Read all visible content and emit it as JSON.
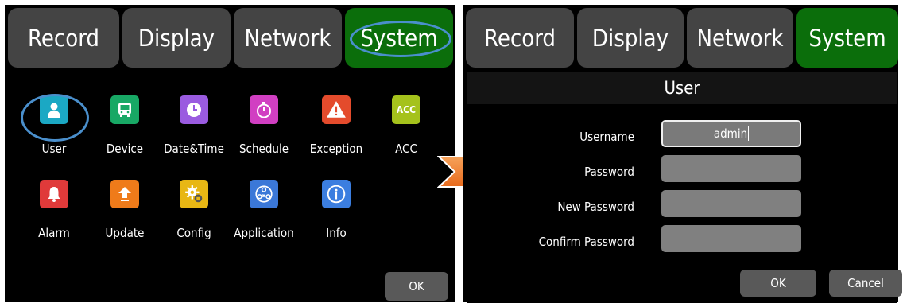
{
  "tabs": [
    "Record",
    "Display",
    "Network",
    "System"
  ],
  "active_tab": "System",
  "grid_items": [
    {
      "label": "User",
      "icon": "user-icon",
      "color": "#1ba8c4"
    },
    {
      "label": "Device",
      "icon": "bus-icon",
      "color": "#18a865"
    },
    {
      "label": "Date&Time",
      "icon": "clock-icon",
      "color": "#9a5be0"
    },
    {
      "label": "Schedule",
      "icon": "stopwatch-icon",
      "color": "#d13fc2"
    },
    {
      "label": "Exception",
      "icon": "warning-icon",
      "color": "#e44b2c"
    },
    {
      "label": "ACC",
      "icon": "acc-icon",
      "color": "#a5c21c"
    },
    {
      "label": "Alarm",
      "icon": "bell-icon",
      "color": "#e03a3a"
    },
    {
      "label": "Update",
      "icon": "upload-arrow-icon",
      "color": "#ef7b1a"
    },
    {
      "label": "Config",
      "icon": "config-gear-icon",
      "color": "#e8b714"
    },
    {
      "label": "Application",
      "icon": "app-network-icon",
      "color": "#3b78d8"
    },
    {
      "label": "Info",
      "icon": "info-icon",
      "color": "#3b7ee0"
    }
  ],
  "acc_icon_text": "ACC",
  "left_ok": "OK",
  "dialog": {
    "title": "User",
    "fields": [
      {
        "label": "Username",
        "value": "admin"
      },
      {
        "label": "Password",
        "value": ""
      },
      {
        "label": "New Password",
        "value": ""
      },
      {
        "label": "Confirm Password",
        "value": ""
      }
    ],
    "ok": "OK",
    "cancel": "Cancel"
  },
  "colors": {
    "tab_bg": "#444444",
    "tab_active": "#0b6e0b",
    "highlight_ellipse": "#4a8fcc",
    "arrow": "#ef7f2a",
    "field_bg": "#808080",
    "button_bg": "#595959"
  }
}
